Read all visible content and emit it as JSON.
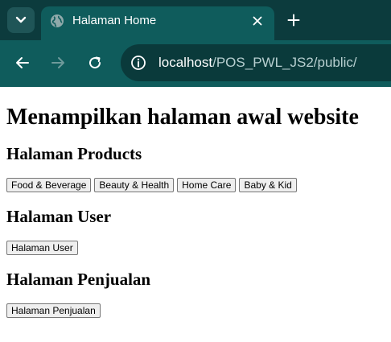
{
  "browser": {
    "tab_title": "Halaman Home",
    "url_host": "localhost",
    "url_path": "/POS_PWL_JS2/public/"
  },
  "page": {
    "heading": "Menampilkan halaman awal website",
    "sections": [
      {
        "title": "Halaman Products",
        "buttons": [
          "Food & Beverage",
          "Beauty & Health",
          "Home Care",
          "Baby & Kid"
        ]
      },
      {
        "title": "Halaman User",
        "buttons": [
          "Halaman User"
        ]
      },
      {
        "title": "Halaman Penjualan",
        "buttons": [
          "Halaman Penjualan"
        ]
      }
    ]
  },
  "colors": {
    "tabbar_bg": "#0c3b3d",
    "toolbar_bg": "#0f5c5c",
    "omnibox_bg": "#0a3a3b"
  }
}
